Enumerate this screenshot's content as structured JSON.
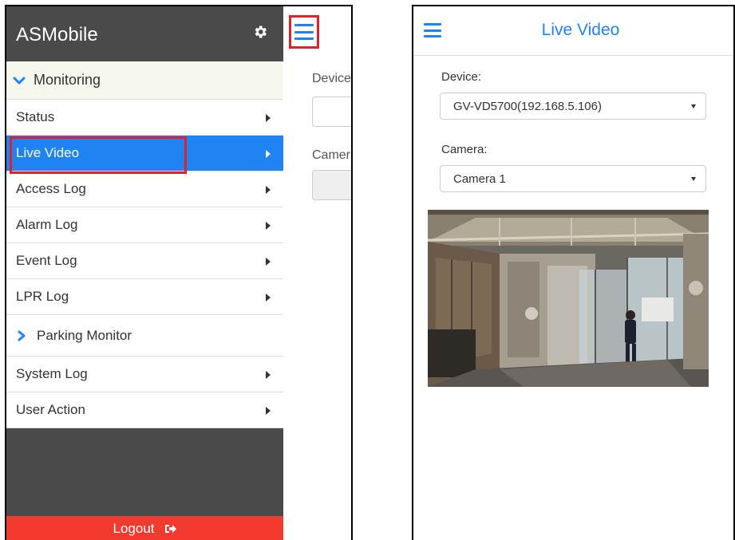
{
  "left_phone": {
    "drawer": {
      "title": "ASMobile",
      "group_label": "Monitoring",
      "items": [
        {
          "label": "Status"
        },
        {
          "label": "Live Video"
        },
        {
          "label": "Access Log"
        },
        {
          "label": "Alarm Log"
        },
        {
          "label": "Event Log"
        },
        {
          "label": "LPR Log"
        },
        {
          "label": "Parking Monitor"
        },
        {
          "label": "System Log"
        },
        {
          "label": "User Action"
        }
      ],
      "logout_label": "Logout"
    },
    "content": {
      "device_label": "Device",
      "camera_label": "Camer"
    }
  },
  "right_phone": {
    "title": "Live Video",
    "device_label": "Device:",
    "device_value": "GV-VD5700(192.168.5.106)",
    "camera_label": "Camera:",
    "camera_value": "Camera 1"
  },
  "colors": {
    "accent": "#1f84f2",
    "drawer_bg": "#4a4a4a",
    "highlight": "#e0202a",
    "logout_bg": "#f23b2e"
  }
}
